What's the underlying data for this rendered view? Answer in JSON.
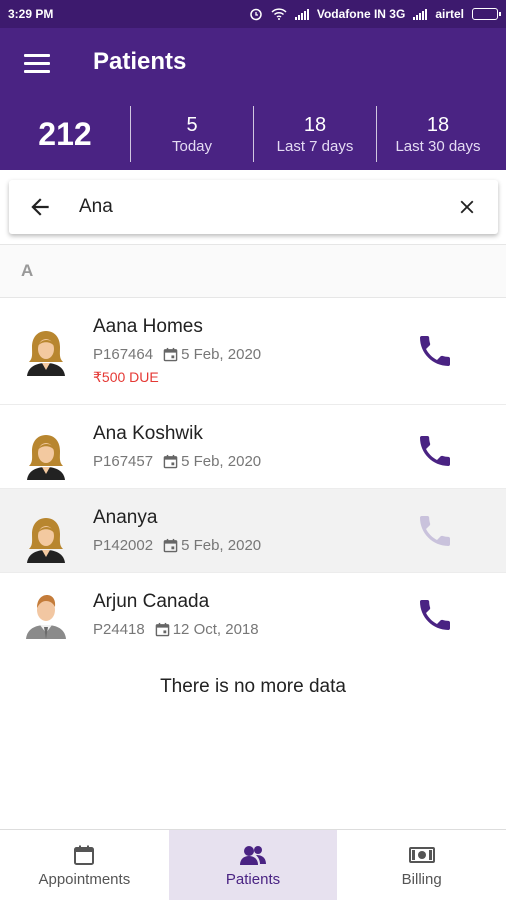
{
  "status_bar": {
    "time": "3:29 PM",
    "carrier1": "Vodafone IN 3G",
    "carrier2": "airtel"
  },
  "app_bar": {
    "title": "Patients",
    "total": "212",
    "stats": [
      {
        "value": "5",
        "label": "Today"
      },
      {
        "value": "18",
        "label": "Last 7 days"
      },
      {
        "value": "18",
        "label": "Last 30 days"
      }
    ]
  },
  "search": {
    "value": "Ana"
  },
  "section": {
    "letter": "A"
  },
  "patients": [
    {
      "name": "Aana Homes",
      "id": "P167464",
      "date": "5 Feb, 2020",
      "due": "₹500 DUE",
      "gender": "female"
    },
    {
      "name": "Ana Koshwik",
      "id": "P167457",
      "date": "5 Feb, 2020",
      "gender": "female"
    },
    {
      "name": "Ananya",
      "id": "P142002",
      "date": "5 Feb, 2020",
      "gender": "female"
    },
    {
      "name": "Arjun Canada",
      "id": "P24418",
      "date": "12 Oct, 2018",
      "gender": "male"
    }
  ],
  "list_footer": "There is no more data",
  "bottom_nav": [
    {
      "label": "Appointments",
      "icon": "calendar-icon"
    },
    {
      "label": "Patients",
      "icon": "patients-icon",
      "active": true
    },
    {
      "label": "Billing",
      "icon": "money-icon"
    }
  ],
  "colors": {
    "primary": "#4a2383",
    "status_bar": "#3d1a6e",
    "due": "#e53935",
    "call_icon": "#4a2383",
    "call_icon_disabled": "#c9c2dc"
  }
}
